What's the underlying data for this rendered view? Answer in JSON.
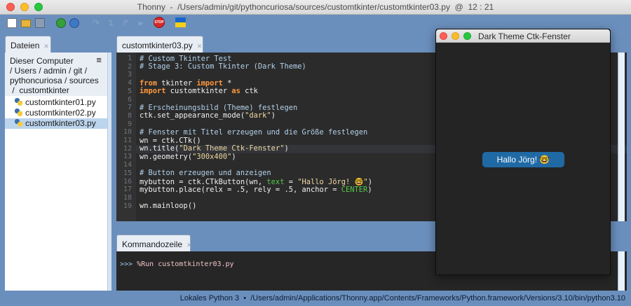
{
  "window": {
    "title": "Thonny  -  /Users/admin/git/pythoncuriosa/sources/customtkinter/customtkinter03.py  @  12 : 21"
  },
  "toolbar": {
    "icons": [
      "new-file-icon",
      "open-file-icon",
      "save-icon",
      "run-icon",
      "debug-icon",
      "step-over-icon",
      "step-into-icon",
      "step-out-icon",
      "resume-icon",
      "stop-icon",
      "ukraine-flag-icon"
    ],
    "stop_label": "STOP",
    "colors": {
      "run": "#35a03a",
      "stop": "#d8282a",
      "flag_blue": "#1a66c8",
      "flag_yellow": "#f5cf18"
    }
  },
  "files": {
    "tab_label": "Dateien",
    "location_lines": [
      "Dieser Computer",
      "/ Users  /  admin  /  git  /",
      "pythoncuriosa  /  sources",
      " /  customtkinter"
    ],
    "menu_icon": "≡",
    "items": [
      {
        "name": "customtkinter01.py",
        "selected": false
      },
      {
        "name": "customtkinter02.py",
        "selected": false
      },
      {
        "name": "customtkinter03.py",
        "selected": true
      }
    ]
  },
  "editor": {
    "tab_label": "customtkinter03.py",
    "current_line": 12,
    "lines": [
      {
        "n": "1",
        "segs": [
          {
            "t": "# Custom Tkinter Test",
            "c": "comment"
          }
        ]
      },
      {
        "n": "2",
        "segs": [
          {
            "t": "# Stage 3: Custom Tkinter (Dark Theme)",
            "c": "comment"
          }
        ]
      },
      {
        "n": "3",
        "segs": []
      },
      {
        "n": "4",
        "segs": [
          {
            "t": "from",
            "c": "kw"
          },
          {
            "t": " tkinter ",
            "c": "plain"
          },
          {
            "t": "import",
            "c": "kw"
          },
          {
            "t": " *",
            "c": "plain"
          }
        ]
      },
      {
        "n": "5",
        "segs": [
          {
            "t": "import",
            "c": "kw"
          },
          {
            "t": " customtkinter ",
            "c": "plain"
          },
          {
            "t": "as",
            "c": "kw"
          },
          {
            "t": " ctk",
            "c": "plain"
          }
        ]
      },
      {
        "n": "6",
        "segs": []
      },
      {
        "n": "7",
        "segs": [
          {
            "t": "# Erscheinungsbild (Theme) festlegen",
            "c": "comment"
          }
        ]
      },
      {
        "n": "8",
        "segs": [
          {
            "t": "ctk.set_appearance_mode(",
            "c": "plain"
          },
          {
            "t": "\"dark\"",
            "c": "str"
          },
          {
            "t": ")",
            "c": "plain"
          }
        ]
      },
      {
        "n": "9",
        "segs": []
      },
      {
        "n": "10",
        "segs": [
          {
            "t": "# Fenster mit Titel erzeugen und die Größe festlegen",
            "c": "comment"
          }
        ]
      },
      {
        "n": "11",
        "segs": [
          {
            "t": "wn = ctk.CTk()",
            "c": "plain"
          }
        ]
      },
      {
        "n": "12",
        "segs": [
          {
            "t": "wn.title(",
            "c": "plain"
          },
          {
            "t": "\"Dark Theme Ctk-Fenster\"",
            "c": "str"
          },
          {
            "t": ")",
            "c": "plain"
          }
        ]
      },
      {
        "n": "13",
        "segs": [
          {
            "t": "wn.geometry(",
            "c": "plain"
          },
          {
            "t": "\"300x400\"",
            "c": "str"
          },
          {
            "t": ")",
            "c": "plain"
          }
        ]
      },
      {
        "n": "14",
        "segs": []
      },
      {
        "n": "15",
        "segs": [
          {
            "t": "# Button erzeugen und anzeigen",
            "c": "comment"
          }
        ]
      },
      {
        "n": "16",
        "segs": [
          {
            "t": "mybutton = ctk.CTkButton(wn, ",
            "c": "plain"
          },
          {
            "t": "text",
            "c": "param"
          },
          {
            "t": " = ",
            "c": "plain"
          },
          {
            "t": "\"Hallo Jörg! 🤓\"",
            "c": "str"
          },
          {
            "t": ")",
            "c": "plain"
          }
        ]
      },
      {
        "n": "17",
        "segs": [
          {
            "t": "mybutton.place(relx = .5, rely = .5, anchor = ",
            "c": "plain"
          },
          {
            "t": "CENTER",
            "c": "param"
          },
          {
            "t": ")",
            "c": "plain"
          }
        ]
      },
      {
        "n": "18",
        "segs": []
      },
      {
        "n": "19",
        "segs": [
          {
            "t": "wn.mainloop()",
            "c": "plain"
          }
        ]
      }
    ]
  },
  "shell": {
    "tab_label": "Kommandozeile",
    "prompt": ">>> ",
    "command": "%Run customtkinter03.py"
  },
  "status": {
    "text": "Lokales Python 3  •  /Users/admin/Applications/Thonny.app/Contents/Frameworks/Python.framework/Versions/3.10/bin/python3.10"
  },
  "ctk_window": {
    "title": "Dark Theme Ctk-Fenster",
    "button_label": "Hallo Jörg! 🤓",
    "colors": {
      "background": "#242424",
      "button": "#1f6aa5"
    }
  },
  "colors": {
    "chrome": "#6b8fbd",
    "editor_bg": "#2b2b2b",
    "selection": "#bcd4ec"
  }
}
